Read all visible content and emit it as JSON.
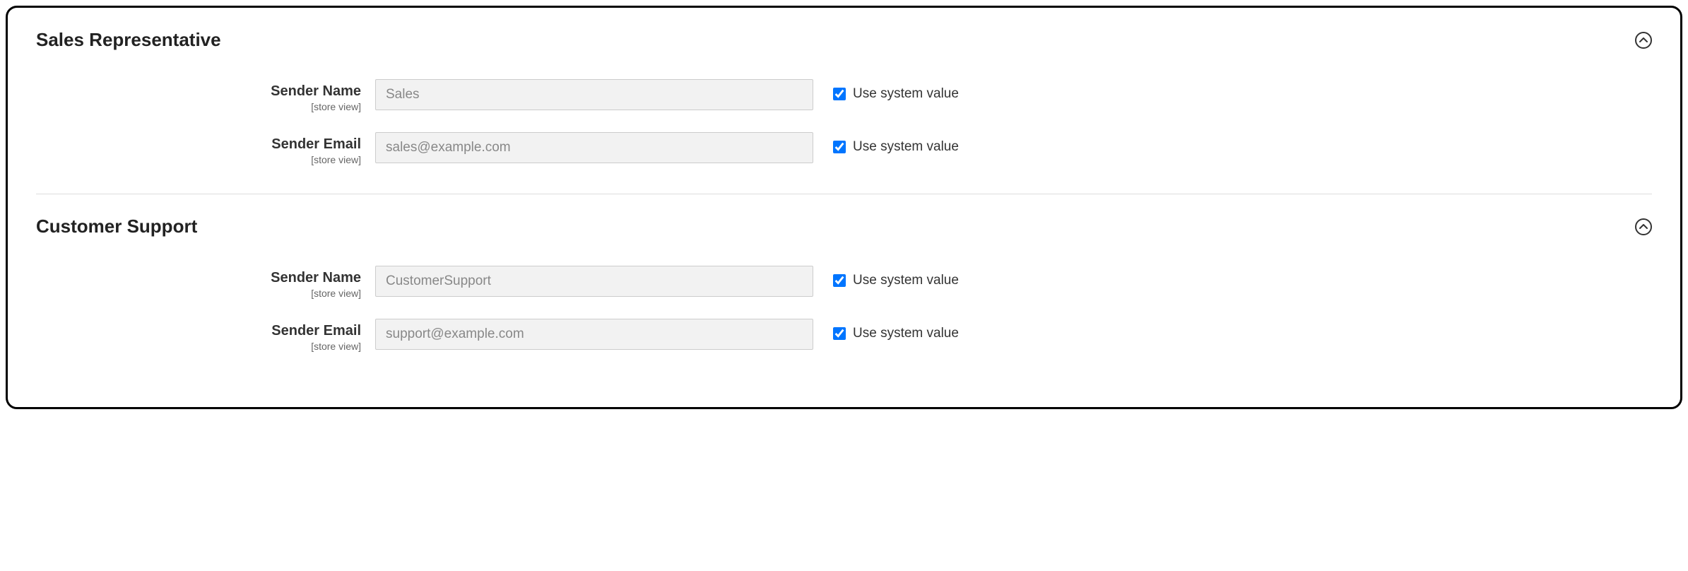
{
  "common": {
    "scope_label": "[store view]",
    "use_system_label": "Use system value"
  },
  "sections": {
    "sales_rep": {
      "title": "Sales Representative",
      "sender_name": {
        "label": "Sender Name",
        "value": "Sales"
      },
      "sender_email": {
        "label": "Sender Email",
        "value": "sales@example.com"
      }
    },
    "customer_support": {
      "title": "Customer Support",
      "sender_name": {
        "label": "Sender Name",
        "value": "CustomerSupport"
      },
      "sender_email": {
        "label": "Sender Email",
        "value": "support@example.com"
      }
    }
  }
}
